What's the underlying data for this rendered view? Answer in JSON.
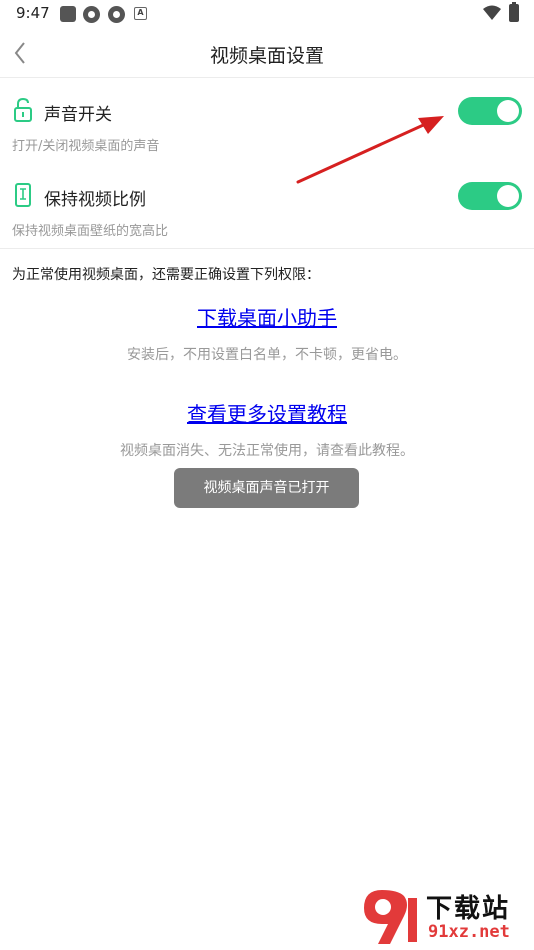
{
  "status_bar": {
    "time": "9:47",
    "icons": [
      "notification-square-icon",
      "app-icon",
      "app-icon",
      "a-box-icon",
      "wifi-icon",
      "battery-charging-icon"
    ]
  },
  "header": {
    "title": "视频桌面设置",
    "back_icon": "chevron-left-icon"
  },
  "settings": [
    {
      "icon": "unlock-icon",
      "label": "声音开关",
      "description": "打开/关闭视频桌面的声音",
      "enabled": true
    },
    {
      "icon": "phone-frame-icon",
      "label": "保持视频比例",
      "description": "保持视频桌面壁纸的宽高比",
      "enabled": true
    }
  ],
  "permissions": {
    "intro": "为正常使用视频桌面，还需要正确设置下列权限：",
    "links": [
      {
        "label": "下载桌面小助手",
        "description": "安装后，不用设置白名单，不卡顿，更省电。"
      },
      {
        "label": "查看更多设置教程",
        "description": "视频桌面消失、无法正常使用，请查看此教程。"
      }
    ]
  },
  "toast": {
    "message": "视频桌面声音已打开"
  },
  "watermark": {
    "text": "下载站",
    "url": "91xz.net"
  },
  "colors": {
    "accent": "#2ccb85",
    "link": "#0000ee",
    "arrow": "#d62020"
  }
}
